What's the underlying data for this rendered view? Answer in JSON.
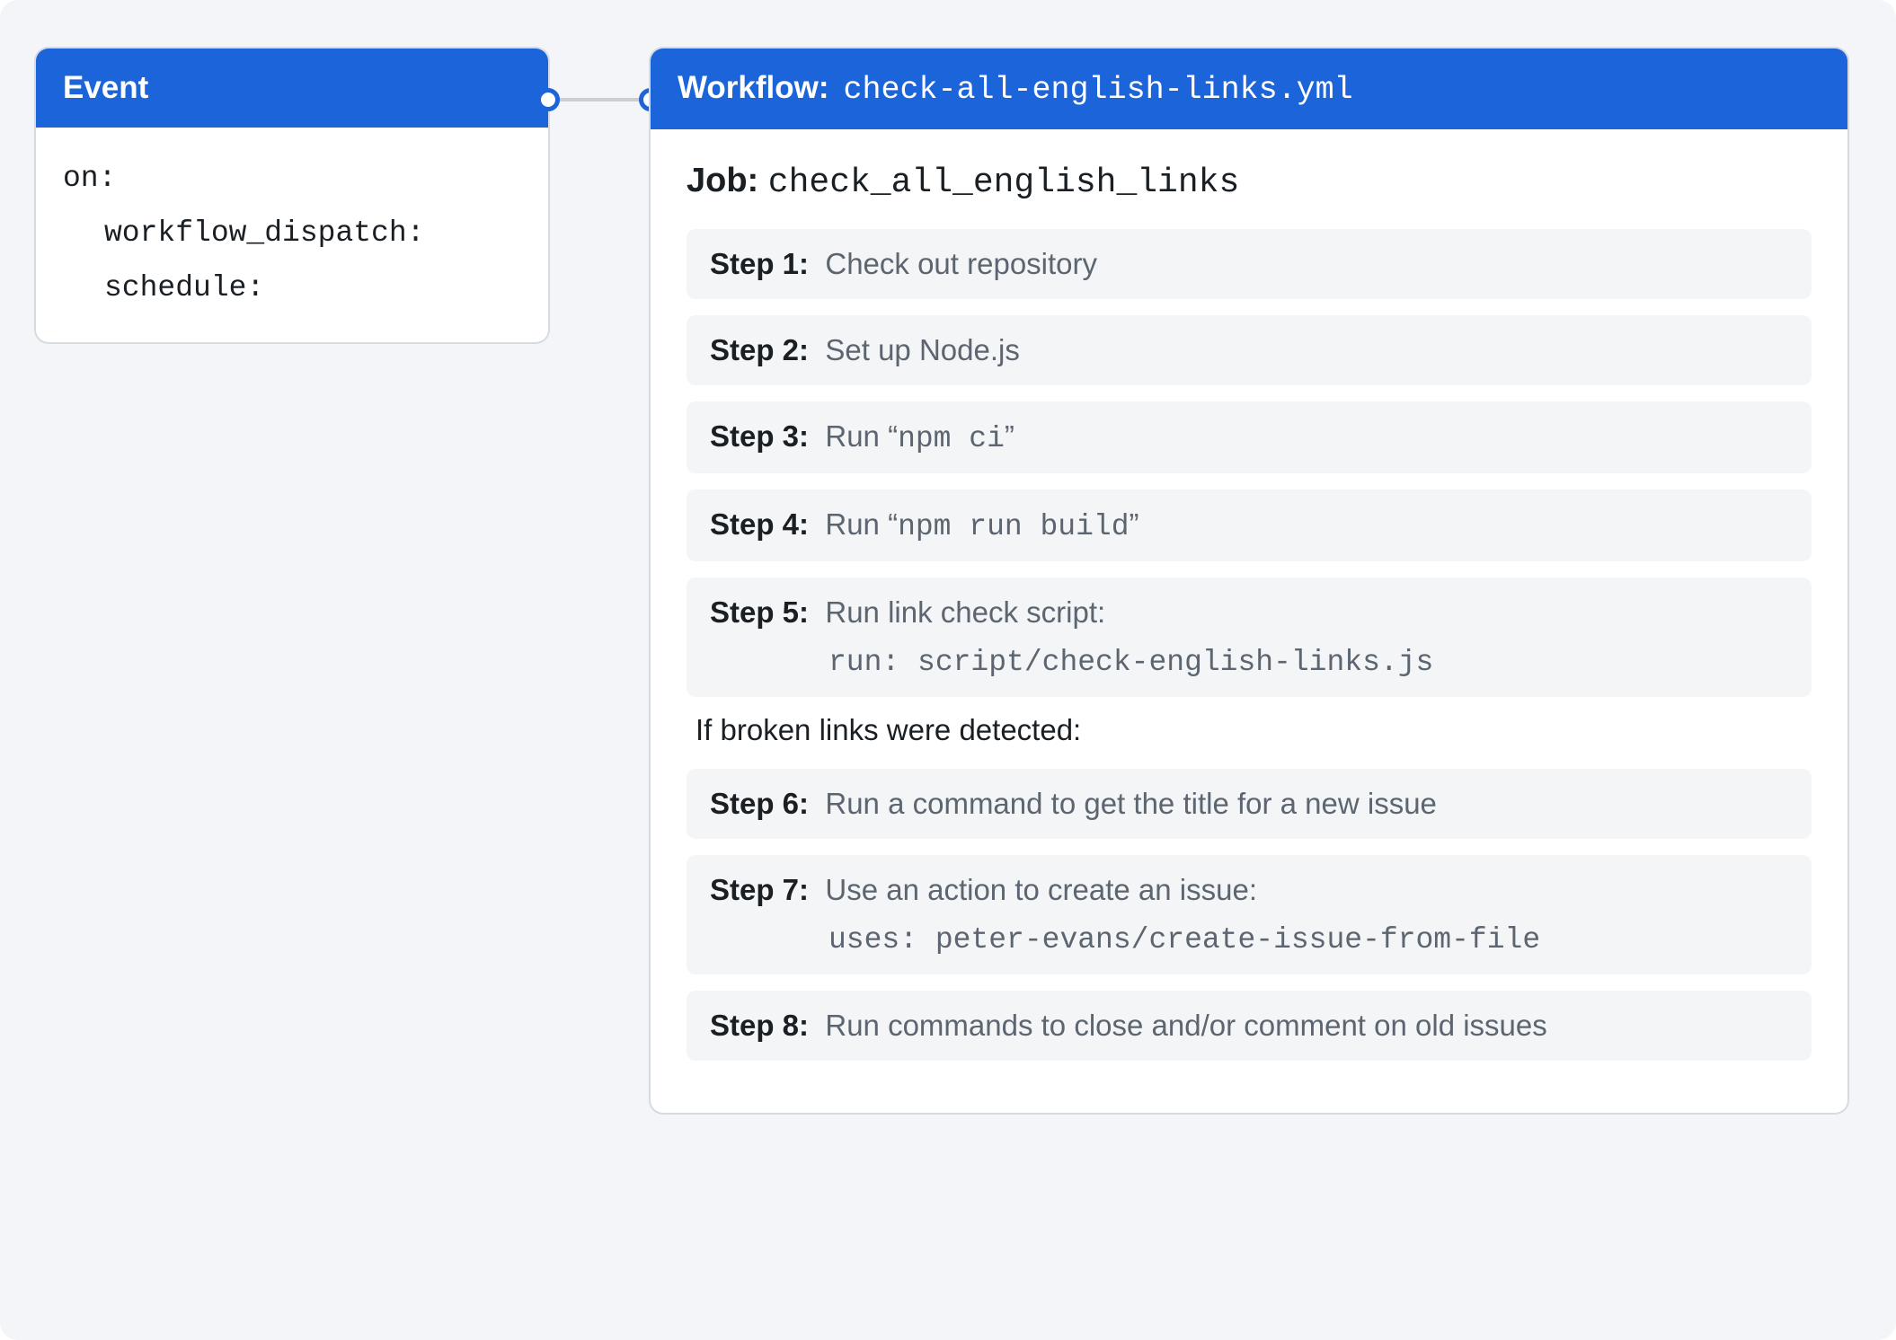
{
  "event": {
    "header": "Event",
    "on_key": "on:",
    "triggers": [
      "workflow_dispatch:",
      "schedule:"
    ]
  },
  "workflow": {
    "header_label": "Workflow:",
    "header_file": "check-all-english-links.yml",
    "job": {
      "label": "Job:",
      "name": "check_all_english_links"
    },
    "steps_a": [
      {
        "label": "Step 1:",
        "desc": "Check out repository"
      },
      {
        "label": "Step 2:",
        "desc": "Set up Node.js"
      },
      {
        "label": "Step 3:",
        "desc_pre": "Run “",
        "code": "npm ci",
        "desc_post": "”"
      },
      {
        "label": "Step 4:",
        "desc_pre": "Run “",
        "code": "npm run build",
        "desc_post": "”"
      },
      {
        "label": "Step 5:",
        "desc": "Run link check script:",
        "sub": "run: script/check-english-links.js"
      }
    ],
    "conditional_note": "If broken links were detected:",
    "steps_b": [
      {
        "label": "Step 6:",
        "desc": "Run a command to get the title for a new issue"
      },
      {
        "label": "Step 7:",
        "desc": "Use an action to create an issue:",
        "sub": "uses: peter-evans/create-issue-from-file"
      },
      {
        "label": "Step 8:",
        "desc": "Run commands to close and/or comment on old issues"
      }
    ]
  }
}
